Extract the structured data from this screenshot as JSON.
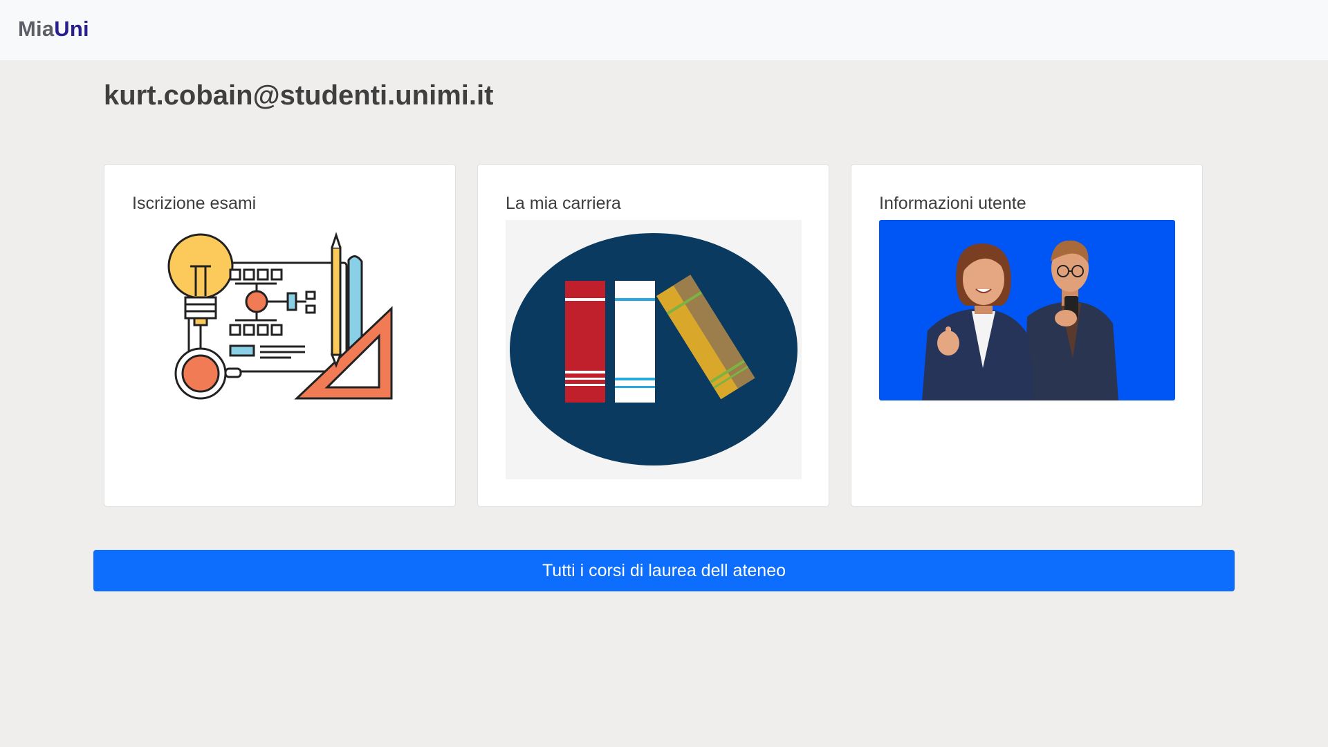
{
  "navbar": {
    "brand_part1": "Mia",
    "brand_part2": "Uni"
  },
  "user": {
    "email": "kurt.cobain@studenti.unimi.it"
  },
  "cards": [
    {
      "title": "Iscrizione esami",
      "image": "exam-planning-illustration"
    },
    {
      "title": "La mia carriera",
      "image": "books-illustration"
    },
    {
      "title": "Informazioni utente",
      "image": "users-illustration"
    }
  ],
  "cta": {
    "label": "Tutti i corsi di laurea dell ateneo"
  },
  "colors": {
    "primary": "#0d6efd",
    "brand_dark": "#2a1f8f",
    "background": "#efeeec"
  }
}
